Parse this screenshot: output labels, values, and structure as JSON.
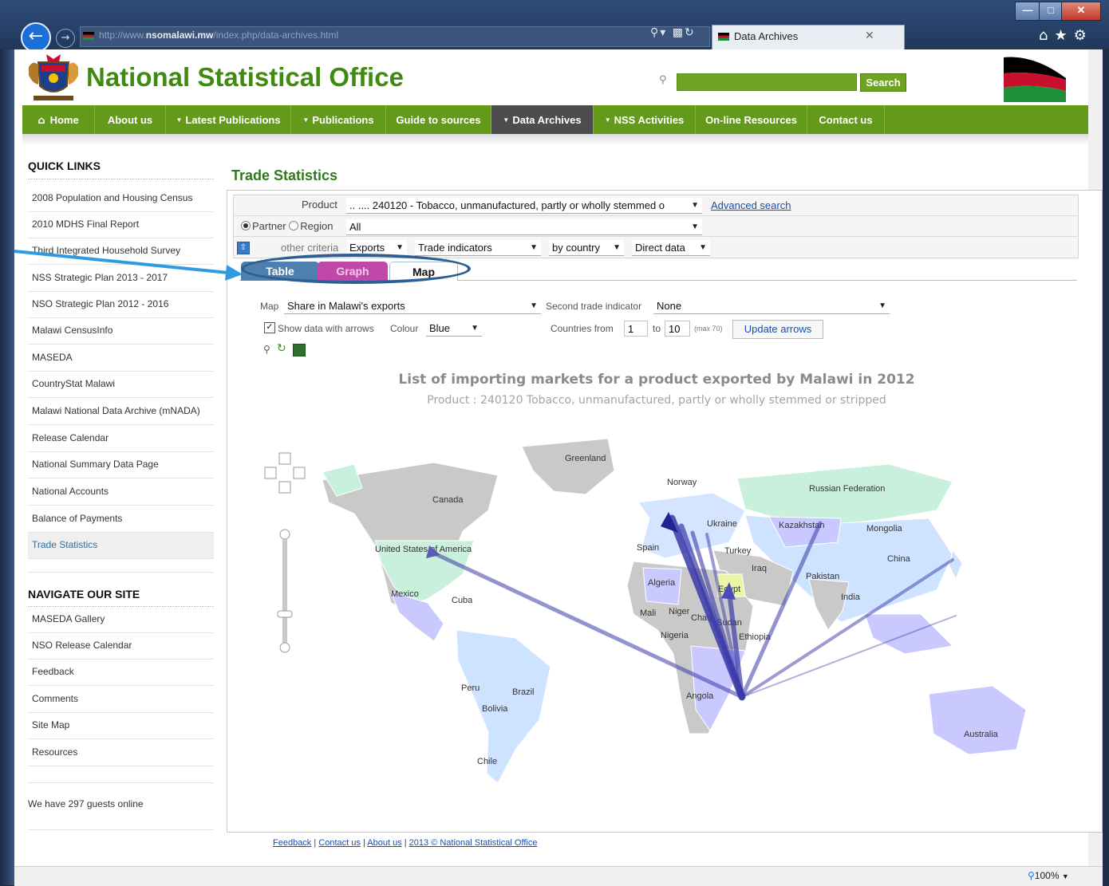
{
  "browser": {
    "url_prefix": "http://www.",
    "url_domain": "nsomalawi.mw",
    "url_path": "/index.php/data-archives.html",
    "tab_title": "Data Archives",
    "zoom": "100%"
  },
  "header": {
    "site_title": "National Statistical Office",
    "search_button": "Search"
  },
  "nav": [
    {
      "label": "Home",
      "icon": "home-icon"
    },
    {
      "label": "About us"
    },
    {
      "label": "Latest Publications",
      "caret": true
    },
    {
      "label": "Publications",
      "caret": true
    },
    {
      "label": "Guide to sources"
    },
    {
      "label": "Data Archives",
      "caret": true,
      "active": true
    },
    {
      "label": "NSS Activities",
      "caret": true
    },
    {
      "label": "On-line Resources"
    },
    {
      "label": "Contact us"
    }
  ],
  "sidebar": {
    "quick_links_title": "QUICK LINKS",
    "quick_links": [
      "2008 Population and Housing Census",
      "2010 MDHS Final Report",
      "Third Integrated Household Survey",
      "NSS Strategic Plan 2013 - 2017",
      "NSO Strategic Plan 2012 - 2016",
      "Malawi CensusInfo",
      "MASEDA",
      "CountryStat Malawi",
      "Malawi National Data Archive (mNADA)",
      "Release Calendar",
      "National Summary Data Page",
      "National Accounts",
      "Balance of Payments",
      "Trade Statistics"
    ],
    "navigate_title": "NAVIGATE OUR SITE",
    "navigate_links": [
      "MASEDA Gallery",
      "NSO Release Calendar",
      "Feedback",
      "Comments",
      "Site Map",
      "Resources"
    ],
    "guests": "We have 297 guests online"
  },
  "content": {
    "title": "Trade Statistics",
    "product_label": "Product",
    "product_value": ".. .... 240120 - Tobacco, unmanufactured, partly or wholly stemmed o",
    "advanced_search": "Advanced search",
    "partner_label": "Partner",
    "region_label": "Region",
    "partner_value": "All",
    "other_criteria_label": "other criteria",
    "exports_value": "Exports",
    "trade_indicators": "Trade indicators",
    "by_country": "by country",
    "direct_data": "Direct data",
    "tabs": [
      "Table",
      "Graph",
      "Map"
    ],
    "map_label": "Map",
    "map_value": "Share in Malawi's exports",
    "second_indicator_label": "Second trade indicator",
    "second_indicator_value": "None",
    "show_arrows_label": "Show data with arrows",
    "colour_label": "Colour",
    "colour_value": "Blue",
    "countries_from_label": "Countries from",
    "countries_from": "1",
    "to_label": "to",
    "countries_to": "10",
    "max_label": "(max 70)",
    "update_button": "Update arrows",
    "map_title": "List of importing markets for a product exported by Malawi in 2012",
    "map_subtitle": "Product : 240120 Tobacco, unmanufactured, partly or wholly stemmed or stripped"
  },
  "map_labels": [
    "Greenland",
    "Canada",
    "Norway",
    "Russian Federation",
    "Ukraine",
    "Kazakhstan",
    "Mongolia",
    "United States of America",
    "Spain",
    "Turkey",
    "China",
    "Iraq",
    "Algeria",
    "Egypt",
    "Pakistan",
    "Mexico",
    "Cuba",
    "India",
    "Mali",
    "Niger",
    "Chad",
    "Sudan",
    "Nigeria",
    "Ethiopia",
    "Peru",
    "Brazil",
    "Bolivia",
    "Angola",
    "Australia",
    "Chile"
  ],
  "footer": {
    "feedback": "Feedback",
    "contact": "Contact us",
    "about": "About us",
    "copyright": "2013 © National Statistical Office"
  }
}
